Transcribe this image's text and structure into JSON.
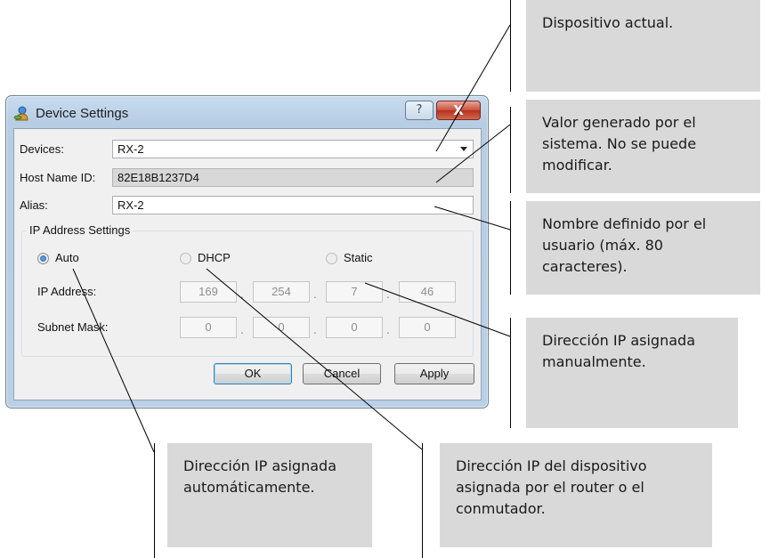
{
  "window": {
    "title": "Device Settings",
    "help_label": "?",
    "close_label": "X"
  },
  "form": {
    "devices_label": "Devices:",
    "devices_value": "RX-2",
    "host_label": "Host Name ID:",
    "host_value": "82E18B1237D4",
    "alias_label": "Alias:",
    "alias_value": "RX-2"
  },
  "ip_settings": {
    "group_title": "IP Address Settings",
    "modes": [
      {
        "label": "Auto",
        "selected": true
      },
      {
        "label": "DHCP",
        "selected": false
      },
      {
        "label": "Static",
        "selected": false
      }
    ],
    "ip_label": "IP Address:",
    "ip_octets": [
      "169",
      "254",
      "7",
      "46"
    ],
    "subnet_label": "Subnet Mask:",
    "subnet_octets": [
      "0",
      "0",
      "0",
      "0"
    ],
    "separator": "."
  },
  "buttons": {
    "ok": "OK",
    "cancel": "Cancel",
    "apply": "Apply"
  },
  "callouts": {
    "current_device": "Dispositivo actual.",
    "system_value": "Valor generado por el sistema. No se puede modificar.",
    "user_name": "Nombre definido por el usuario (máx. 80 caracteres).",
    "manual_ip": "Dirección IP asignada manualmente.",
    "auto_ip": "Dirección IP asignada automáticamente.",
    "dhcp_ip": "Dirección IP del dispositivo asignada por el router o el conmutador."
  },
  "colors": {
    "callout_bg": "#d9d9d9",
    "window_frame": "#b9cfe6",
    "close_button": "#c74a38"
  }
}
